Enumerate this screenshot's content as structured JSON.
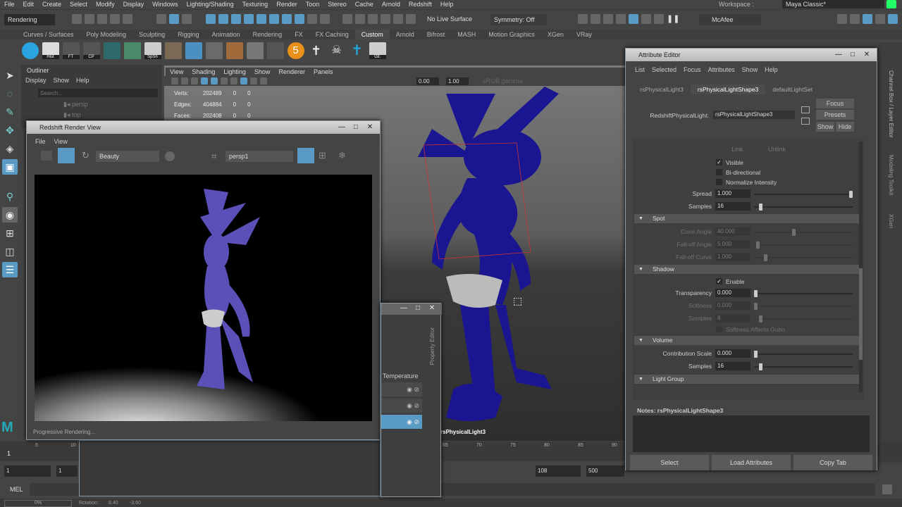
{
  "menubar": [
    "File",
    "Edit",
    "Create",
    "Select",
    "Modify",
    "Display",
    "Windows",
    "Lighting/Shading",
    "Texturing",
    "Render",
    "Toon",
    "Stereo",
    "Cache",
    "Arnold",
    "Redshift",
    "Help"
  ],
  "status": {
    "menuset": "Rendering",
    "live_surface": "No Live Surface",
    "symmetry": "Symmetry: Off",
    "user": "McAfee",
    "workspace_label": "Workspace :",
    "workspace": "Maya Classic*"
  },
  "shelf_tabs": [
    "Curves / Surfaces",
    "Poly Modeling",
    "Sculpting",
    "Rigging",
    "Animation",
    "Rendering",
    "FX",
    "FX Caching",
    "Custom",
    "Arnold",
    "Bifrost",
    "MASH",
    "Motion Graphics",
    "XGen",
    "VRay"
  ],
  "shelf_active": "Custom",
  "shelf_icons": [
    {
      "name": "redshift-icon",
      "label": ""
    },
    {
      "name": "history-icon",
      "label": "Hist"
    },
    {
      "name": "freeze-transform-icon",
      "label": "FT"
    },
    {
      "name": "center-pivot-icon",
      "label": "CP"
    },
    {
      "name": "hypershade-icon",
      "label": ""
    },
    {
      "name": "uv-editor-icon",
      "label": ""
    },
    {
      "name": "spreadsheet-icon",
      "label": "SpSh"
    },
    {
      "name": "brush-icon",
      "label": ""
    },
    {
      "name": "sculpt-icon",
      "label": ""
    },
    {
      "name": "grid-icon",
      "label": ""
    },
    {
      "name": "paint-icon",
      "label": ""
    },
    {
      "name": "blocks-icon",
      "label": ""
    },
    {
      "name": "uvn-icon",
      "label": ""
    },
    {
      "name": "five-icon",
      "label": "5"
    },
    {
      "name": "biped-icon",
      "label": ""
    },
    {
      "name": "skull-icon",
      "label": ""
    },
    {
      "name": "ctrl-rig-icon",
      "label": ""
    },
    {
      "name": "graph-editor-icon",
      "label": "GE"
    }
  ],
  "outliner": {
    "title": "Outliner",
    "menu": [
      "Display",
      "Show",
      "Help"
    ],
    "search_placeholder": "Search...",
    "items": [
      "persp",
      "top"
    ]
  },
  "viewport": {
    "menu": [
      "View",
      "Shading",
      "Lighting",
      "Show",
      "Renderer",
      "Panels"
    ],
    "exposure": "0.00",
    "gamma": "1.00",
    "color_space": "sRGB gamma",
    "hud": [
      [
        "Verts:",
        "202489",
        "0",
        "0"
      ],
      [
        "Edges:",
        "404884",
        "0",
        "0"
      ],
      [
        "Faces:",
        "202408",
        "0",
        "0"
      ]
    ],
    "light_label": "rsPhysicalLight3"
  },
  "render_view": {
    "title": "Redshift Render View",
    "menu": [
      "File",
      "View"
    ],
    "aov": "Beauty",
    "camera": "persp1",
    "status": "Progressive Rendering..."
  },
  "property_editor": {
    "title": "Property Editor",
    "column": "Temperature"
  },
  "attr_editor": {
    "title": "Attribute Editor",
    "menu": [
      "List",
      "Selected",
      "Focus",
      "Attributes",
      "Show",
      "Help"
    ],
    "tabs": [
      "rsPhysicalLight3",
      "rsPhysicalLightShape3",
      "defaultLightSet"
    ],
    "active_tab": "rsPhysicalLightShape3",
    "node_label": "RedshiftPhysicalLight:",
    "node_value": "rsPhysicalLightShape3",
    "focus": "Focus",
    "presets": "Presets",
    "show": "Show",
    "hide": "Hide",
    "link": "Link",
    "unlink": "Unlink",
    "visible": "Visible",
    "bidirectional": "Bi-directional",
    "normalize": "Normalize Intensity",
    "spread_label": "Spread",
    "spread": "1.000",
    "spread_frac": 1.0,
    "samples_label": "Samples",
    "samples": "16",
    "samples_frac": 0.05,
    "spot": "Spot",
    "cone_label": "Cone Angle",
    "cone": "40.000",
    "cone_frac": 0.4,
    "falloff_angle_label": "Fall-off Angle",
    "falloff_angle": "5.000",
    "falloff_angle_frac": 0.02,
    "falloff_curve_label": "Fall-off Curve",
    "falloff_curve": "1.000",
    "falloff_curve_frac": 0.1,
    "shadow": "Shadow",
    "enable": "Enable",
    "transparency_label": "Transparency",
    "transparency": "0.000",
    "softness_label": "Softness",
    "softness": "0.000",
    "shadow_samples_label": "Samples",
    "shadow_samples": "8",
    "softness_gobo": "Softness Affects Gobo",
    "volume": "Volume",
    "contrib_label": "Contribution Scale",
    "contrib": "0.000",
    "vol_samples_label": "Samples",
    "vol_samples": "16",
    "light_group": "Light Group",
    "notes": "Notes:  rsPhysicalLightShape3",
    "buttons": [
      "Select",
      "Load Attributes",
      "Copy Tab"
    ]
  },
  "right_tabs": [
    "Channel Box / Layer Editor",
    "Modeling Toolkit",
    "XGen"
  ],
  "timeline": {
    "ticks": [
      "5",
      "10",
      "65",
      "70",
      "75",
      "80",
      "85",
      "90"
    ],
    "current": "1",
    "start": "1",
    "range_start": "1",
    "range_end": "108",
    "end": "500"
  },
  "command": {
    "lang": "MEL"
  },
  "helpline": {
    "progress": "0%",
    "rotation_label": "Rotation:",
    "rx": "8.40",
    "ry": "-3.60"
  }
}
